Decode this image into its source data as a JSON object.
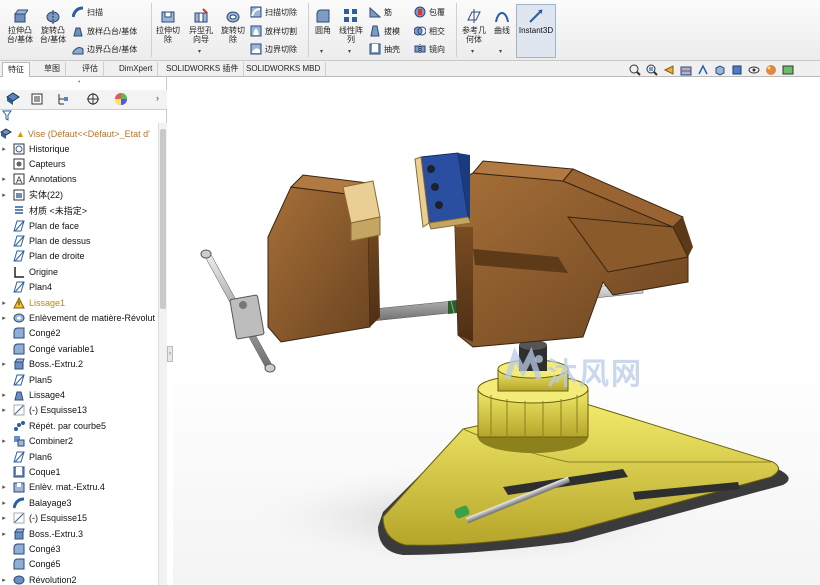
{
  "ribbon": {
    "extrude_boss": "拉伸凸\n台/基体",
    "revolve_boss": "旋转凸\n台/基体",
    "sweep": "扫描",
    "loft_boss": "放样凸台/基体",
    "boundary_boss": "边界凸台/基体",
    "extrude_cut": "拉伸切\n除",
    "hole_wizard": "异型孔\n向导",
    "revolve_cut": "旋转切\n除",
    "swept_cut": "扫描切除",
    "lofted_cut": "放样切割",
    "boundary_cut": "边界切除",
    "fillet": "圆角",
    "linear_pattern": "线性阵\n列",
    "rib": "筋",
    "draft": "拔模",
    "shell": "抽壳",
    "wrap": "包覆",
    "intersect": "相交",
    "mirror": "镜向",
    "ref_geometry": "参考几\n何体",
    "curves": "曲线",
    "instant3d": "Instant3D"
  },
  "tabs": [
    "特征",
    "草图",
    "评估",
    "DimXpert",
    "SOLIDWORKS 插件",
    "SOLIDWORKS MBD"
  ],
  "active_tab": 0,
  "tree": {
    "root": "Vise  (Défaut<<Défaut>_Etat d'",
    "items": [
      {
        "label": "Historique",
        "icon": "history-icon",
        "exp": true
      },
      {
        "label": "Capteurs",
        "icon": "sensor-icon",
        "exp": false
      },
      {
        "label": "Annotations",
        "icon": "annotations-icon",
        "exp": true
      },
      {
        "label": "实体(22)",
        "icon": "solid-bodies-icon",
        "exp": true
      },
      {
        "label": "材质 <未指定>",
        "icon": "material-icon",
        "exp": false
      },
      {
        "label": "Plan de face",
        "icon": "plane-icon",
        "exp": false
      },
      {
        "label": "Plan de dessus",
        "icon": "plane-icon",
        "exp": false
      },
      {
        "label": "Plan de droite",
        "icon": "plane-icon",
        "exp": false
      },
      {
        "label": "Origine",
        "icon": "origin-icon",
        "exp": false
      },
      {
        "label": "Plan4",
        "icon": "plane-icon",
        "exp": false
      },
      {
        "label": "Lissage1",
        "icon": "loft-warning-icon",
        "exp": true,
        "warn": true
      },
      {
        "label": "Enlèvement de matière-Révolut",
        "icon": "revolve-cut-icon",
        "exp": true
      },
      {
        "label": "Congé2",
        "icon": "fillet-icon",
        "exp": false
      },
      {
        "label": "Congé variable1",
        "icon": "fillet-icon",
        "exp": false
      },
      {
        "label": "Boss.-Extru.2",
        "icon": "extrude-icon",
        "exp": true
      },
      {
        "label": "Plan5",
        "icon": "plane-icon",
        "exp": false
      },
      {
        "label": "Lissage4",
        "icon": "loft-icon",
        "exp": true
      },
      {
        "label": "(-) Esquisse13",
        "icon": "sketch-icon",
        "exp": true
      },
      {
        "label": "Répét. par courbe5",
        "icon": "pattern-icon",
        "exp": false
      },
      {
        "label": "Combiner2",
        "icon": "combine-icon",
        "exp": true
      },
      {
        "label": "Plan6",
        "icon": "plane-icon",
        "exp": false
      },
      {
        "label": "Coque1",
        "icon": "shell-icon",
        "exp": false
      },
      {
        "label": "Enlèv. mat.-Extru.4",
        "icon": "extrude-cut-icon",
        "exp": true
      },
      {
        "label": "Balayage3",
        "icon": "sweep-icon",
        "exp": true
      },
      {
        "label": "(-) Esquisse15",
        "icon": "sketch-icon",
        "exp": true
      },
      {
        "label": "Boss.-Extru.3",
        "icon": "extrude-icon",
        "exp": true
      },
      {
        "label": "Congé3",
        "icon": "fillet-icon",
        "exp": false
      },
      {
        "label": "Congé5",
        "icon": "fillet-icon",
        "exp": false
      },
      {
        "label": "Révolution2",
        "icon": "revolve-icon",
        "exp": true
      }
    ]
  },
  "watermark": "沐风网",
  "colors": {
    "wood": "#8a5a2b",
    "base": "#e8e04a",
    "jaw_pad": "#e9cf93",
    "blue_plate": "#2b4fa0",
    "spring": "#3d6b3d"
  }
}
